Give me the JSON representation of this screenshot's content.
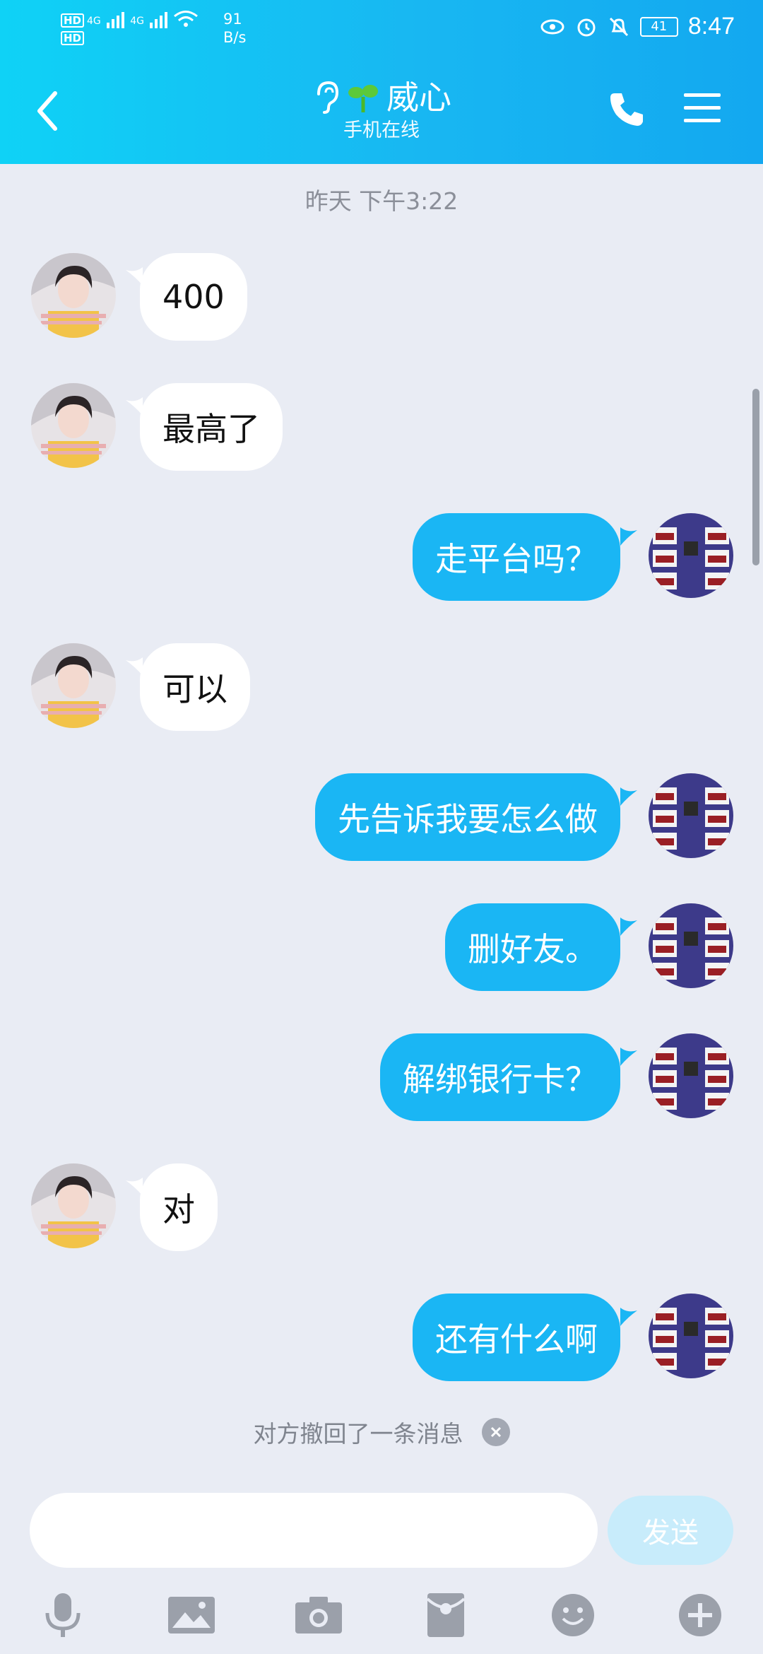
{
  "status_bar": {
    "left_tag_1": "HD",
    "left_tag_2": "HD",
    "network_1": "4G",
    "network_2": "4G",
    "net_speed_value": "91",
    "net_speed_unit": "B/s",
    "battery": "41",
    "time": "8:47"
  },
  "header": {
    "title": "威心",
    "subtitle": "手机在线"
  },
  "chat": {
    "date_separator": "昨天 下午3:22",
    "messages": [
      {
        "side": "left",
        "text": "400"
      },
      {
        "side": "left",
        "text": "最高了"
      },
      {
        "side": "right",
        "text": "走平台吗？"
      },
      {
        "side": "left",
        "text": "可以"
      },
      {
        "side": "right",
        "text": "先告诉我要怎么做"
      },
      {
        "side": "right",
        "text": "删好友。"
      },
      {
        "side": "right",
        "text": "解绑银行卡？"
      },
      {
        "side": "left",
        "text": "对"
      },
      {
        "side": "right",
        "text": "还有什么啊"
      }
    ],
    "recall_notice": "对方撤回了一条消息"
  },
  "composer": {
    "input_value": "",
    "send_label": "发送"
  },
  "toolbar": {
    "icons": [
      "microphone-icon",
      "image-icon",
      "camera-icon",
      "red-packet-icon",
      "emoji-icon",
      "plus-icon"
    ]
  },
  "colors": {
    "header_start": "#0fd2f6",
    "header_end": "#13a8f0",
    "outgoing_bubble": "#1ab6f4",
    "incoming_bubble": "#ffffff",
    "background": "#e9ecf4",
    "send_disabled": "#c8ecfb"
  }
}
